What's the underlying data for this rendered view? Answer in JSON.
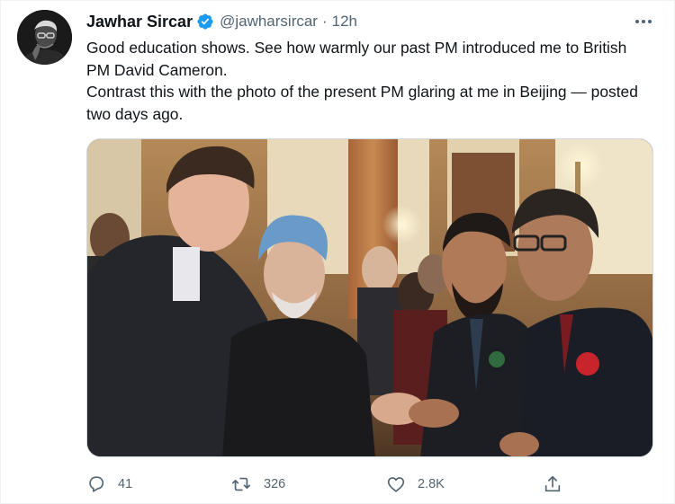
{
  "tweet": {
    "author": {
      "display_name": "Jawhar Sircar",
      "handle": "@jawharsircar",
      "verified": true,
      "avatar_icon": "profile-photo"
    },
    "separator": "·",
    "time": "12h",
    "text_lines": [
      "Good education shows. See how warmly our past PM introduced me to British PM David Cameron.",
      "Contrast this with the photo of the present PM glaring at me in Beijing — posted two days ago."
    ],
    "media": {
      "type": "photo",
      "icon": "photo-image"
    },
    "actions": {
      "reply": {
        "icon": "reply-icon",
        "count": "41"
      },
      "retweet": {
        "icon": "retweet-icon",
        "count": "326"
      },
      "like": {
        "icon": "heart-icon",
        "count": "2.8K"
      },
      "share": {
        "icon": "share-icon"
      }
    },
    "more_icon": "more-icon"
  },
  "colors": {
    "text_primary": "#0f1419",
    "text_secondary": "#536471",
    "verified_blue": "#1d9bf0",
    "border": "#cfd9de"
  }
}
